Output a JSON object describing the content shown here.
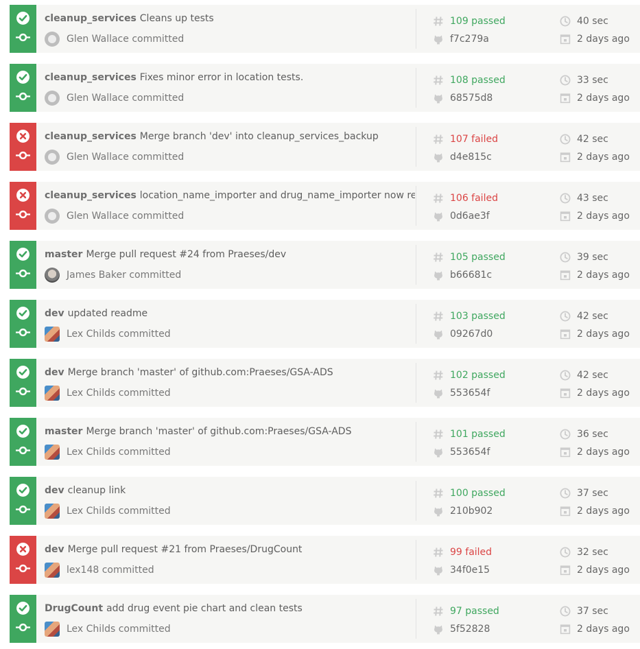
{
  "colors": {
    "passed": "#3fa75f",
    "failed": "#db4545",
    "row_background": "#f6f6f4",
    "meta_icon": "#cccccc"
  },
  "icons": {
    "status_passed": "check-circle-icon",
    "status_failed": "x-circle-icon",
    "commit": "commit-icon",
    "build_number": "hash-icon",
    "commit_sha": "github-octocat-icon",
    "duration": "clock-icon",
    "finished": "calendar-icon"
  },
  "builds": [
    {
      "state": "passed",
      "branch": "cleanup_services",
      "message": "Cleans up tests",
      "avatar": "placeholder",
      "author": "Glen Wallace committed",
      "number_text": "109 passed",
      "sha": "f7c279a",
      "duration": "40 sec",
      "finished": "2 days ago"
    },
    {
      "state": "passed",
      "branch": "cleanup_services",
      "message": "Fixes minor error in location tests.",
      "avatar": "placeholder",
      "author": "Glen Wallace committed",
      "number_text": "108 passed",
      "sha": "68575d8",
      "duration": "33 sec",
      "finished": "2 days ago"
    },
    {
      "state": "failed",
      "branch": "cleanup_services",
      "message": "Merge branch 'dev' into cleanup_services_backup",
      "avatar": "placeholder",
      "author": "Glen Wallace committed",
      "number_text": "107 failed",
      "sha": "d4e815c",
      "duration": "42 sec",
      "finished": "2 days ago"
    },
    {
      "state": "failed",
      "branch": "cleanup_services",
      "message": "location_name_importer and drug_name_importer now reuse",
      "avatar": "placeholder",
      "author": "Glen Wallace committed",
      "number_text": "106 failed",
      "sha": "0d6ae3f",
      "duration": "43 sec",
      "finished": "2 days ago"
    },
    {
      "state": "passed",
      "branch": "master",
      "message": "Merge pull request #24 from Praeses/dev",
      "avatar": "photo-gray",
      "author": "James Baker committed",
      "number_text": "105 passed",
      "sha": "b66681c",
      "duration": "39 sec",
      "finished": "2 days ago"
    },
    {
      "state": "passed",
      "branch": "dev",
      "message": "updated readme",
      "avatar": "photo-color",
      "author": "Lex Childs committed",
      "number_text": "103 passed",
      "sha": "09267d0",
      "duration": "42 sec",
      "finished": "2 days ago"
    },
    {
      "state": "passed",
      "branch": "dev",
      "message": "Merge branch 'master' of github.com:Praeses/GSA-ADS",
      "avatar": "photo-color",
      "author": "Lex Childs committed",
      "number_text": "102 passed",
      "sha": "553654f",
      "duration": "42 sec",
      "finished": "2 days ago"
    },
    {
      "state": "passed",
      "branch": "master",
      "message": "Merge branch 'master' of github.com:Praeses/GSA-ADS",
      "avatar": "photo-color",
      "author": "Lex Childs committed",
      "number_text": "101 passed",
      "sha": "553654f",
      "duration": "36 sec",
      "finished": "2 days ago"
    },
    {
      "state": "passed",
      "branch": "dev",
      "message": "cleanup link",
      "avatar": "photo-color",
      "author": "Lex Childs committed",
      "number_text": "100 passed",
      "sha": "210b902",
      "duration": "37 sec",
      "finished": "2 days ago"
    },
    {
      "state": "failed",
      "branch": "dev",
      "message": "Merge pull request #21 from Praeses/DrugCount",
      "avatar": "photo-color",
      "author": "lex148 committed",
      "number_text": "99 failed",
      "sha": "34f0e15",
      "duration": "32 sec",
      "finished": "2 days ago"
    },
    {
      "state": "passed",
      "branch": "DrugCount",
      "message": "add drug event pie chart and clean tests",
      "avatar": "photo-color",
      "author": "Lex Childs committed",
      "number_text": "97 passed",
      "sha": "5f52828",
      "duration": "37 sec",
      "finished": "2 days ago"
    }
  ]
}
